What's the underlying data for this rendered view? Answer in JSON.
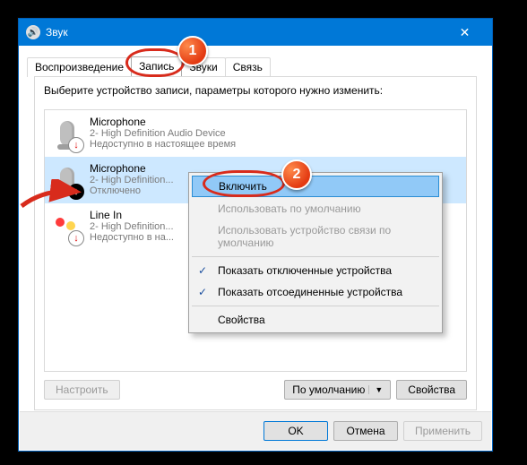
{
  "window": {
    "title": "Звук"
  },
  "tabs": {
    "play": "Воспроизведение",
    "record": "Запись",
    "sounds": "Звуки",
    "comm": "Связь"
  },
  "instruction": "Выберите устройство записи, параметры которого нужно изменить:",
  "devices": [
    {
      "name": "Microphone",
      "sub": "2- High Definition Audio Device",
      "status": "Недоступно в настоящее время"
    },
    {
      "name": "Microphone",
      "sub": "2- High Definition...",
      "status": "Отключено"
    },
    {
      "name": "Line In",
      "sub": "2- High Definition...",
      "status": "Недоступно в на..."
    }
  ],
  "panel_buttons": {
    "configure": "Настроить",
    "default_dd": "По умолчанию",
    "properties": "Свойства"
  },
  "context_menu": {
    "enable": "Включить",
    "use_default": "Использовать по умолчанию",
    "use_comm_default": "Использовать устройство связи по умолчанию",
    "show_disabled": "Показать отключенные устройства",
    "show_disconnected": "Показать отсоединенные устройства",
    "properties": "Свойства"
  },
  "footer": {
    "ok": "OK",
    "cancel": "Отмена",
    "apply": "Применить"
  },
  "callouts": {
    "c1": "1",
    "c2": "2"
  }
}
